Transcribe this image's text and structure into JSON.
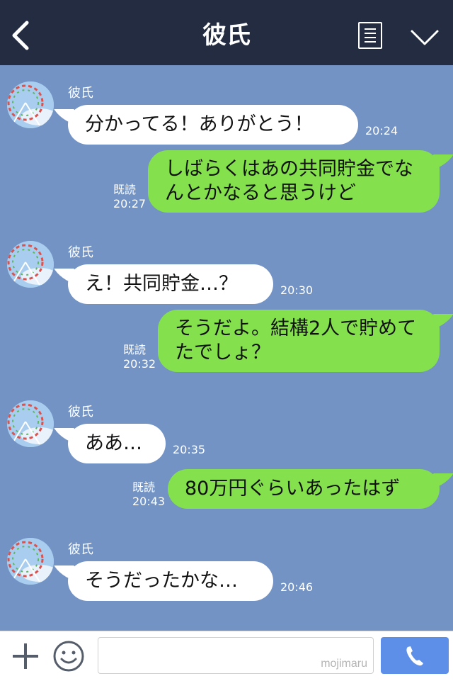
{
  "header": {
    "title": "彼氏",
    "back_icon": "chevron-left-icon",
    "menu_icon": "list-icon",
    "expand_icon": "chevron-down-icon"
  },
  "messages": [
    {
      "from": "partner",
      "sender": "彼氏",
      "text": "分かってる！ありがとう！",
      "time": "20:24"
    },
    {
      "from": "me",
      "status": "既読",
      "time": "20:27",
      "text": "しばらくはあの共同貯金でなんとかなると思うけど"
    },
    {
      "from": "partner",
      "sender": "彼氏",
      "text": "え！共同貯金…？",
      "time": "20:30"
    },
    {
      "from": "me",
      "status": "既読",
      "time": "20:32",
      "text": "そうだよ。結構2人で貯めてたでしょ？"
    },
    {
      "from": "partner",
      "sender": "彼氏",
      "text": "ああ…",
      "time": "20:35"
    },
    {
      "from": "me",
      "status": "既読",
      "time": "20:43",
      "text": "80万円ぐらいあったはず"
    },
    {
      "from": "partner",
      "sender": "彼氏",
      "text": "そうだったかな…",
      "time": "20:46"
    }
  ],
  "footer": {
    "plus_icon": "plus-icon",
    "emoji_icon": "smiley-icon",
    "input_value": "",
    "watermark": "mojimaru",
    "call_icon": "phone-icon"
  },
  "colors": {
    "header_bg": "#232c40",
    "chat_bg": "#7293c4",
    "outgoing_bubble": "#84e04c",
    "incoming_bubble": "#ffffff",
    "call_button": "#5d8fe8"
  }
}
